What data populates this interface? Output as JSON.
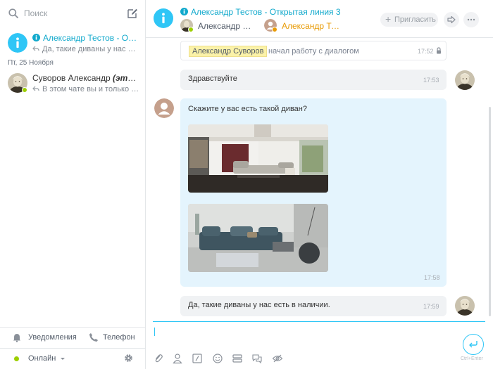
{
  "sidebar": {
    "search_placeholder": "Поиск",
    "recents": [
      {
        "title": "Александр Тестов - Открытая линия 3",
        "subtitle": "Да, такие диваны у нас есть в наличии."
      },
      {
        "title_name": "Суворов Александр ",
        "title_em": "(это вы)",
        "subtitle": "В этом чате вы и только вы..."
      }
    ],
    "date_separator": "Пт, 25 Ноября",
    "bottom": {
      "notifications_label": "Уведомления",
      "phone_label": "Телефон",
      "status_label": "Онлайн"
    }
  },
  "header": {
    "title": "Александр Тестов - Открытая линия 3",
    "participants": [
      {
        "name": "Александр Суворов",
        "color": "#535c69"
      },
      {
        "name": "Александр Тестов",
        "color": "#e89b06"
      }
    ],
    "invite_label": "Пригласить"
  },
  "messages": {
    "system": {
      "name": "Александр Суворов",
      "text": "начал работу с диалогом",
      "time": "17:52"
    },
    "greeting": {
      "text": "Здравствуйте",
      "time": "17:53"
    },
    "question": {
      "text": "Скажите у вас есть такой диван?",
      "time": "17:58"
    },
    "answer": {
      "text": "Да, такие диваны у нас есть в наличии.",
      "time": "17:59"
    }
  },
  "input": {
    "send_hint": "Ctrl+Enter"
  },
  "colors": {
    "accent": "#2fc6f6",
    "online": "#9dcf00",
    "incoming_bubble": "#e4f4fd",
    "outgoing_bubble": "#f0f2f4"
  }
}
